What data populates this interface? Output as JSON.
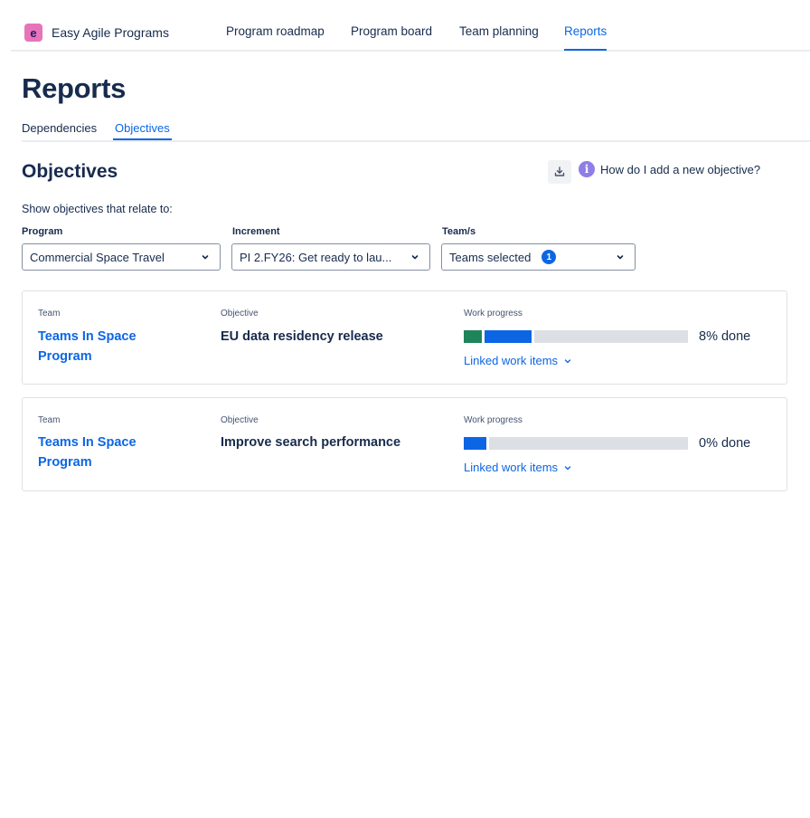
{
  "nav": {
    "brand": {
      "logo_letter": "e",
      "name": "Easy Agile Programs"
    },
    "links": [
      {
        "label": "Program roadmap",
        "active": false
      },
      {
        "label": "Program board",
        "active": false
      },
      {
        "label": "Team planning",
        "active": false
      },
      {
        "label": "Reports",
        "active": true
      }
    ]
  },
  "page": {
    "title": "Reports"
  },
  "subtabs": [
    {
      "label": "Dependencies",
      "active": false
    },
    {
      "label": "Objectives",
      "active": true
    }
  ],
  "section": {
    "title": "Objectives",
    "help_text": "How do I add a new objective?",
    "info_glyph": "i"
  },
  "filters": {
    "intro": "Show objectives that relate to:",
    "program": {
      "label": "Program",
      "value": "Commercial Space Travel"
    },
    "increment": {
      "label": "Increment",
      "value": "PI 2.FY26: Get ready to lau..."
    },
    "teams": {
      "label": "Team/s",
      "value": "Teams selected",
      "count": "1"
    }
  },
  "columns": {
    "team": "Team",
    "objective": "Objective",
    "progress": "Work progress"
  },
  "objectives": [
    {
      "team": "Teams In Space Program",
      "objective": "EU data residency release",
      "progress": {
        "done": 0.08,
        "in_progress": 0.21
      },
      "progress_label": "8% done",
      "linked_label": "Linked work items"
    },
    {
      "team": "Teams In Space Program",
      "objective": "Improve search performance",
      "progress": {
        "done": 0,
        "in_progress": 0.1
      },
      "progress_label": "0% done",
      "linked_label": "Linked work items"
    }
  ],
  "colors": {
    "accent": "#0c66e4",
    "done": "#1f845a",
    "todo": "#dcdfe4",
    "brand_logo": "#e774bb",
    "info": "#8f7ee7"
  },
  "icons": {
    "download": "download-icon",
    "info": "info-icon",
    "chevron": "chevron-down-icon"
  }
}
